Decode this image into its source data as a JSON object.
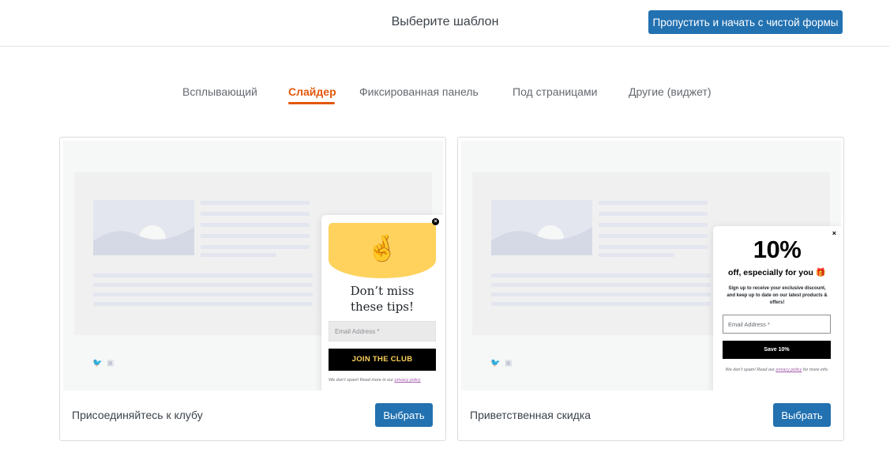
{
  "header": {
    "title": "Выберите шаблон",
    "skip_button": "Пропустить и начать с чистой формы"
  },
  "tabs": [
    {
      "label": "Всплывающий",
      "active": false
    },
    {
      "label": "Слайдер",
      "active": true
    },
    {
      "label": "Фиксированная панель",
      "active": false
    },
    {
      "label": "Под страницами",
      "active": false
    },
    {
      "label": "Другие (виджет)",
      "active": false
    }
  ],
  "colors": {
    "accent": "#e2580d",
    "button": "#2271b1",
    "popup_yellow": "#fed25c"
  },
  "templates": [
    {
      "name": "Присоединяйтесь к клубу",
      "select_label": "Выбрать",
      "popup": {
        "emoji": "🤞",
        "headline_line1": "Don’t miss",
        "headline_line2": "these tips!",
        "email_placeholder": "Email Address *",
        "cta": "JOIN THE CLUB",
        "fine_print": "We don’t spam! Read more in our",
        "fine_link": "privacy policy",
        "close": "×"
      }
    },
    {
      "name": "Приветственная скидка",
      "select_label": "Выбрать",
      "popup": {
        "big": "10%",
        "sub": "off, especially for you 🎁",
        "desc": "Sign up to receive your exclusive discount, and keep up to date on our latest products & offers!",
        "email_placeholder": "Email Address *",
        "cta": "Save 10%",
        "fine_print": "We don’t spam! Read our",
        "fine_link": "privacy policy",
        "fine_after": "for more info.",
        "close": "×"
      }
    }
  ]
}
